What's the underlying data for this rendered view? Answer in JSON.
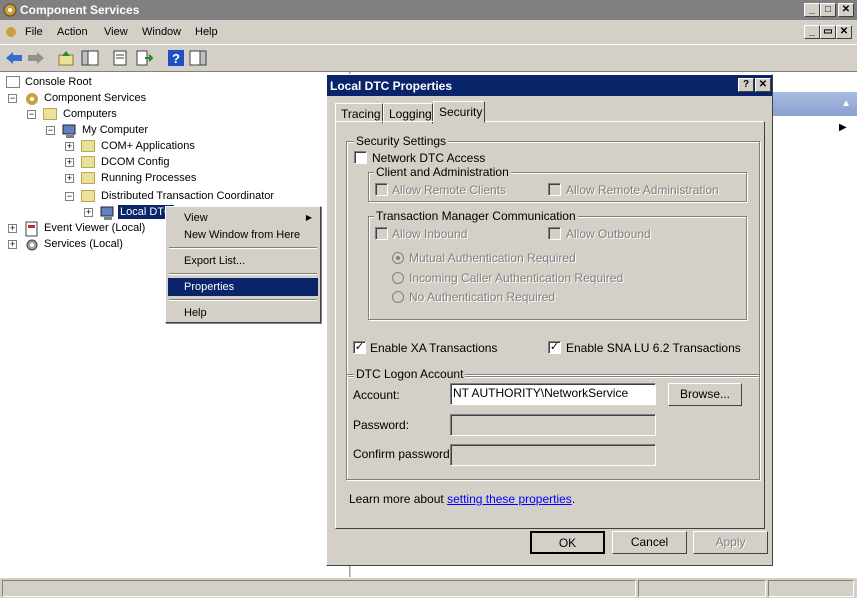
{
  "window": {
    "title": "Component Services"
  },
  "menu": [
    "File",
    "Action",
    "View",
    "Window",
    "Help"
  ],
  "tree": {
    "console_root": "Console Root",
    "component_services": "Component Services",
    "computers": "Computers",
    "my_computer": "My Computer",
    "com_apps": "COM+ Applications",
    "dcom_config": "DCOM Config",
    "running_processes": "Running Processes",
    "dtc": "Distributed Transaction Coordinator",
    "local_dtc": "Local DTC",
    "event_viewer": "Event Viewer (Local)",
    "services": "Services (Local)"
  },
  "context_menu": {
    "view": "View",
    "new_window": "New Window from Here",
    "export_list": "Export List...",
    "properties": "Properties",
    "help": "Help"
  },
  "dialog": {
    "title": "Local DTC Properties",
    "tabs": [
      "Tracing",
      "Logging",
      "Security"
    ],
    "security_settings": "Security Settings",
    "network_dtc_access": "Network DTC Access",
    "client_admin": "Client and Administration",
    "allow_remote_clients": "Allow Remote Clients",
    "allow_remote_admin": "Allow Remote Administration",
    "tm_comm": "Transaction Manager Communication",
    "allow_inbound": "Allow Inbound",
    "allow_outbound": "Allow Outbound",
    "mutual_auth": "Mutual Authentication Required",
    "incoming_auth": "Incoming Caller Authentication Required",
    "no_auth": "No Authentication Required",
    "enable_xa": "Enable XA Transactions",
    "enable_sna": "Enable SNA LU 6.2 Transactions",
    "logon_account": "DTC Logon Account",
    "account_label": "Account:",
    "account_value": "NT AUTHORITY\\NetworkService",
    "browse": "Browse...",
    "password_label": "Password:",
    "confirm_label": "Confirm password:",
    "learn_more": "Learn more about ",
    "learn_link": "setting these properties",
    "learn_end": ".",
    "ok": "OK",
    "cancel": "Cancel",
    "apply": "Apply"
  }
}
